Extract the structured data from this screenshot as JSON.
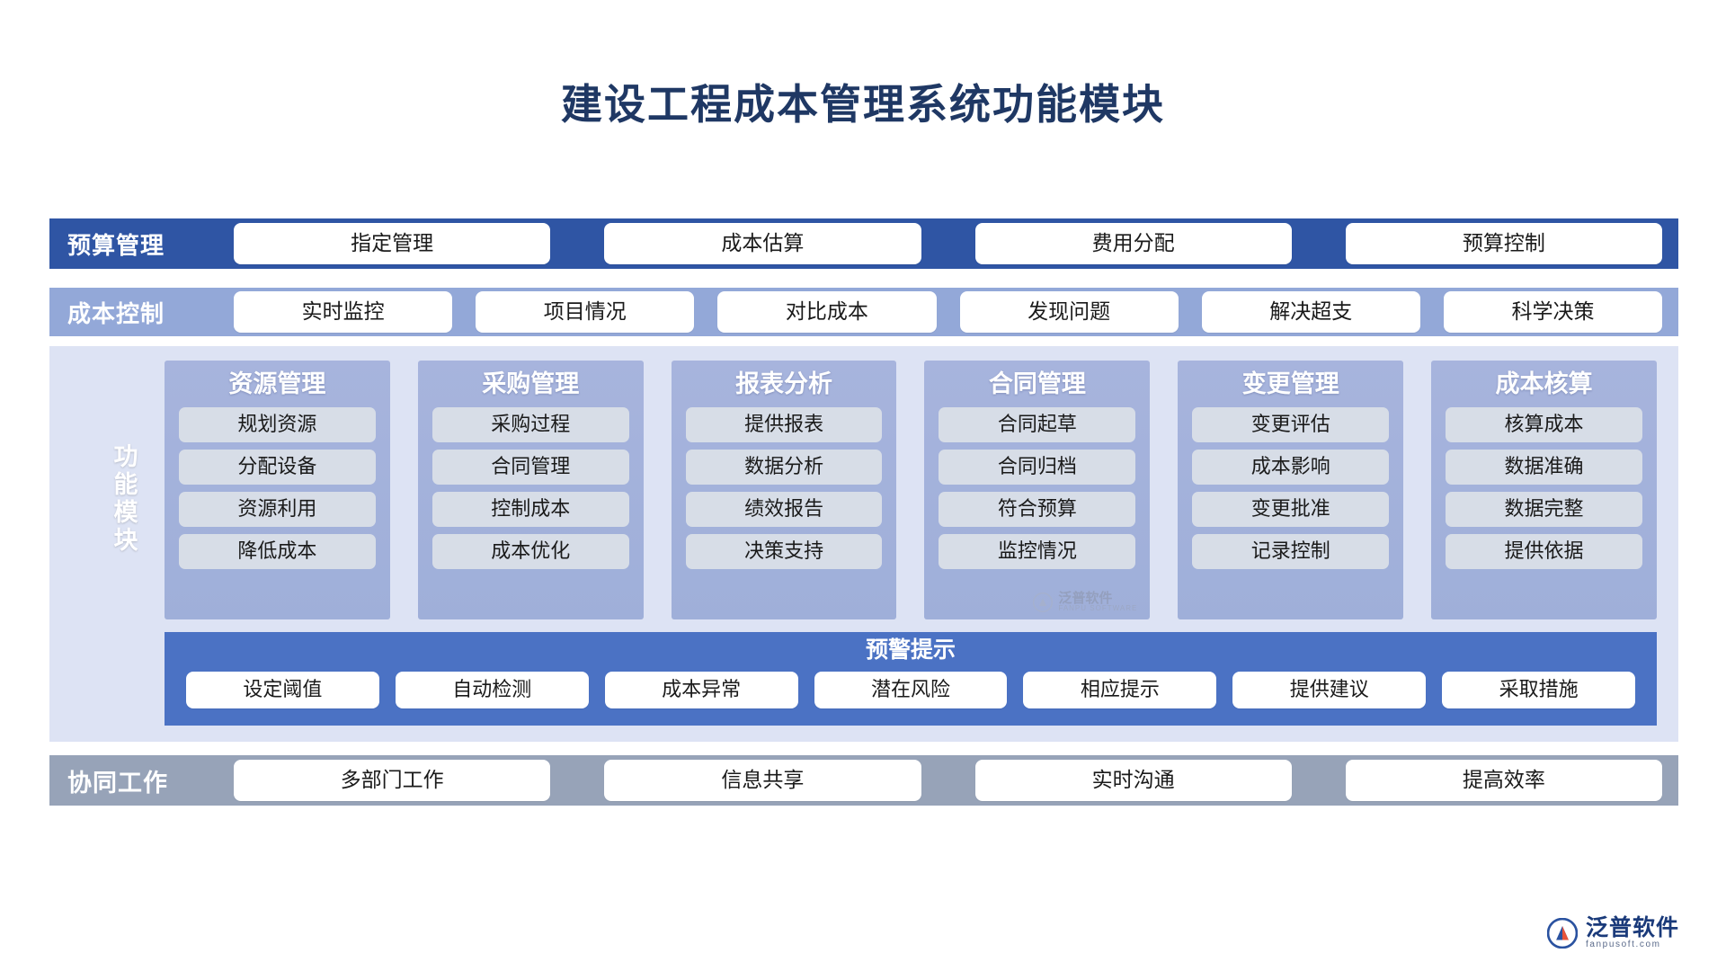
{
  "title": "建设工程成本管理系统功能模块",
  "budget_band": {
    "label": "预算管理",
    "bg": "#2f55a4",
    "items": [
      "指定管理",
      "成本估算",
      "费用分配",
      "预算控制"
    ]
  },
  "cost_band": {
    "label": "成本控制",
    "bg": "#93a8d8",
    "items": [
      "实时监控",
      "项目情况",
      "对比成本",
      "发现问题",
      "解决超支",
      "科学决策"
    ]
  },
  "module_section": {
    "side_label": "功能模块",
    "bg": "#dde3f4",
    "columns": [
      {
        "title": "资源管理",
        "items": [
          "规划资源",
          "分配设备",
          "资源利用",
          "降低成本"
        ]
      },
      {
        "title": "采购管理",
        "items": [
          "采购过程",
          "合同管理",
          "控制成本",
          "成本优化"
        ]
      },
      {
        "title": "报表分析",
        "items": [
          "提供报表",
          "数据分析",
          "绩效报告",
          "决策支持"
        ]
      },
      {
        "title": "合同管理",
        "items": [
          "合同起草",
          "合同归档",
          "符合预算",
          "监控情况"
        ]
      },
      {
        "title": "变更管理",
        "items": [
          "变更评估",
          "成本影响",
          "变更批准",
          "记录控制"
        ]
      },
      {
        "title": "成本核算",
        "items": [
          "核算成本",
          "数据准确",
          "数据完整",
          "提供依据"
        ]
      }
    ],
    "watermark": {
      "cn": "泛普软件",
      "en": "FANPU SOFTWARE"
    }
  },
  "warning_strip": {
    "title": "预警提示",
    "bg": "#4b72c4",
    "items": [
      "设定阈值",
      "自动检测",
      "成本异常",
      "潜在风险",
      "相应提示",
      "提供建议",
      "采取措施"
    ]
  },
  "collab_band": {
    "label": "协同工作",
    "bg": "#97a3b8",
    "items": [
      "多部门工作",
      "信息共享",
      "实时沟通",
      "提高效率"
    ]
  },
  "footer_logo": {
    "cn": "泛普软件",
    "en": "fanpusoft.com"
  },
  "colors": {
    "title": "#1f3864",
    "pill_bg": "#ffffff",
    "module_col_bg": "#a7b4dd",
    "module_item_bg": "#d7dde7"
  }
}
